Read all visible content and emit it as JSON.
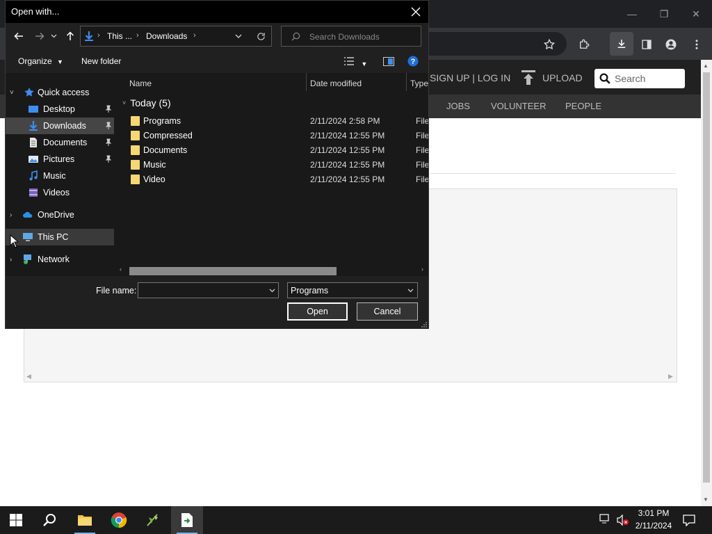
{
  "dialog": {
    "title": "Open with...",
    "address": {
      "seg1": "This ...",
      "seg2": "Downloads"
    },
    "search_placeholder": "Search Downloads",
    "organize_label": "Organize",
    "new_folder_label": "New folder",
    "nav": {
      "quick_access": "Quick access",
      "desktop": "Desktop",
      "downloads": "Downloads",
      "documents": "Documents",
      "pictures": "Pictures",
      "music": "Music",
      "videos": "Videos",
      "onedrive": "OneDrive",
      "this_pc": "This PC",
      "network": "Network"
    },
    "columns": {
      "name": "Name",
      "date": "Date modified",
      "type": "Type"
    },
    "group": "Today (5)",
    "files": [
      {
        "name": "Programs",
        "date": "2/11/2024 2:58 PM",
        "type": "File fo"
      },
      {
        "name": "Compressed",
        "date": "2/11/2024 12:55 PM",
        "type": "File fo"
      },
      {
        "name": "Documents",
        "date": "2/11/2024 12:55 PM",
        "type": "File fo"
      },
      {
        "name": "Music",
        "date": "2/11/2024 12:55 PM",
        "type": "File fo"
      },
      {
        "name": "Video",
        "date": "2/11/2024 12:55 PM",
        "type": "File fo"
      }
    ],
    "file_name_label": "File name:",
    "file_name_value": "",
    "file_type_value": "Programs",
    "open_label": "Open",
    "cancel_label": "Cancel"
  },
  "website": {
    "auth": "SIGN UP | LOG IN",
    "upload": "UPLOAD",
    "search_placeholder": "Search",
    "nav": [
      "JOBS",
      "VOLUNTEER",
      "PEOPLE"
    ]
  },
  "taskbar": {
    "time": "3:01 PM",
    "date": "2/11/2024"
  },
  "colors": {
    "folder": "#f7d774",
    "accent": "#4a9eff",
    "dialog_bg": "#202020"
  }
}
